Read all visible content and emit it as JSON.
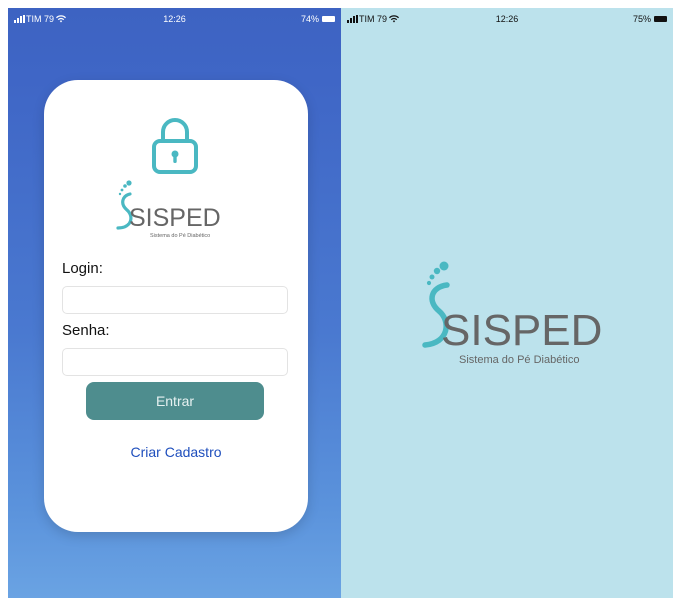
{
  "left_screen": {
    "status": {
      "carrier": "TIM 79",
      "time": "12:26",
      "battery": "74%"
    },
    "logo": {
      "brand": "SISPED",
      "tagline": "Sistema do Pé Diabético"
    },
    "login_label": "Login:",
    "login_value": "",
    "password_label": "Senha:",
    "password_value": "",
    "submit_label": "Entrar",
    "register_link": "Criar Cadastro"
  },
  "right_screen": {
    "status": {
      "carrier": "TIM 79",
      "time": "12:26",
      "battery": "75%"
    },
    "logo": {
      "brand": "SISPED",
      "tagline": "Sistema do Pé Diabético"
    }
  },
  "colors": {
    "gradient_top": "#3d63c2",
    "gradient_bottom": "#6aa3e3",
    "teal": "#4ab8c2",
    "button": "#4e8d8e",
    "link": "#1f4fbd",
    "splash_bg": "#bce2ec",
    "logo_gray": "#666666"
  },
  "icons": [
    "signal-icon",
    "wifi-icon",
    "battery-icon",
    "lock-icon",
    "footprint-logo"
  ]
}
